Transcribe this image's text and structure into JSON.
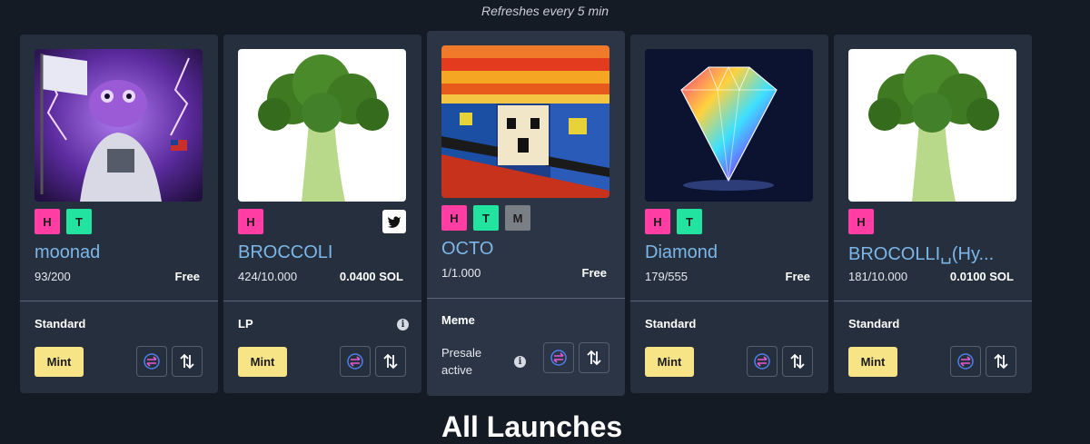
{
  "header": {
    "refresh_note": "Refreshes every 5 min"
  },
  "cards": [
    {
      "name": "moonad",
      "supply": "93/200",
      "price": "Free",
      "type": "Standard",
      "badges": [
        "H",
        "T"
      ],
      "twitter": false,
      "mint_label": "Mint",
      "image": "purple-frog-astronaut-monad"
    },
    {
      "name": "BROCCOLI",
      "supply": "424/10.000",
      "price": "0.0400 SOL",
      "type": "LP",
      "badges": [
        "H"
      ],
      "twitter": true,
      "mint_label": "Mint",
      "image": "broccoli"
    },
    {
      "name": "OCTO",
      "supply": "1/1.000",
      "price": "Free",
      "type": "Meme",
      "badges": [
        "H",
        "T",
        "M"
      ],
      "twitter": false,
      "status": "Presale active",
      "image": "pixel-scream"
    },
    {
      "name": "Diamond",
      "supply": "179/555",
      "price": "Free",
      "type": "Standard",
      "badges": [
        "H",
        "T"
      ],
      "twitter": false,
      "mint_label": "Mint",
      "image": "rainbow-diamond"
    },
    {
      "name": "BROCOLLI␣(Hy...",
      "supply": "181/10.000",
      "price": "0.0100 SOL",
      "type": "Standard",
      "badges": [
        "H"
      ],
      "twitter": false,
      "mint_label": "Mint",
      "image": "broccoli"
    }
  ],
  "icons": {
    "swap": "swap-icon",
    "trade": "trade-arrows-icon",
    "info": "info-icon",
    "twitter": "twitter-icon"
  },
  "colors": {
    "badge_h": "#ff3da3",
    "badge_t": "#22e3a0",
    "badge_m": "#7a7f86",
    "mint": "#f7e486",
    "name": "#7cb7e8"
  },
  "section": {
    "title": "All Launches"
  }
}
